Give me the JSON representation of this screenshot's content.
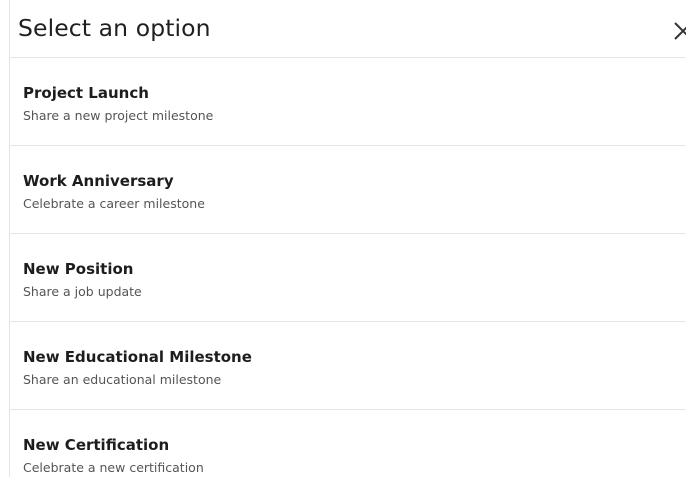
{
  "modal": {
    "title": "Select an option",
    "close_icon": "close-icon"
  },
  "options": [
    {
      "title": "Project Launch",
      "subtitle": "Share a new project milestone"
    },
    {
      "title": "Work Anniversary",
      "subtitle": "Celebrate a career milestone"
    },
    {
      "title": "New Position",
      "subtitle": "Share a job update"
    },
    {
      "title": "New Educational Milestone",
      "subtitle": "Share an educational milestone"
    },
    {
      "title": "New Certification",
      "subtitle": "Celebrate a new certification"
    }
  ],
  "colors": {
    "title_text": "#1f1f1f",
    "subtitle_text": "#555555",
    "divider": "#e6e6e6"
  }
}
